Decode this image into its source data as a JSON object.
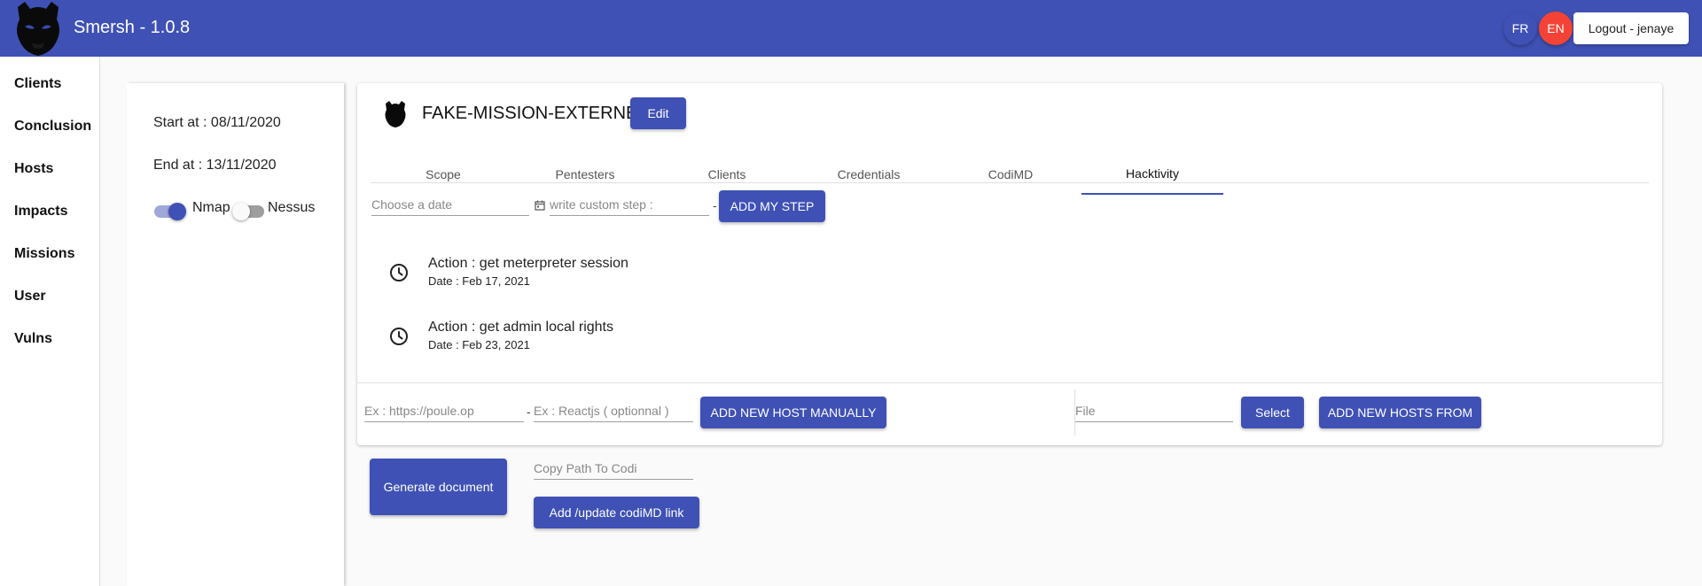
{
  "app": {
    "title": "Smersh - 1.0.8",
    "logo_icon": "panther-head-icon"
  },
  "header": {
    "lang_fr": "FR",
    "lang_en": "EN",
    "logout_label": "Logout - jenaye"
  },
  "colors": {
    "primary": "#3f51b5",
    "accent": "#f44336"
  },
  "sidebar": {
    "items": [
      {
        "label": "Clients"
      },
      {
        "label": "Conclusion"
      },
      {
        "label": "Hosts"
      },
      {
        "label": "Impacts"
      },
      {
        "label": "Missions"
      },
      {
        "label": "User"
      },
      {
        "label": "Vulns"
      }
    ]
  },
  "left_panel": {
    "start": "Start at : 08/11/2020",
    "end": "End at : 13/11/2020",
    "nmap_label": "Nmap",
    "nessus_label": "Nessus",
    "nmap_on": true,
    "nessus_on": false
  },
  "mission": {
    "name": "FAKE-MISSION-EXTERNE",
    "edit_label": "Edit",
    "tabs": [
      {
        "label": "Scope"
      },
      {
        "label": "Pentesters"
      },
      {
        "label": "Clients"
      },
      {
        "label": "Credentials"
      },
      {
        "label": "CodiMD"
      },
      {
        "label": "Hacktivity"
      }
    ],
    "active_tab": "Hacktivity"
  },
  "step_form": {
    "date_placeholder": "Choose a date",
    "calendar_icon": "calendar-icon",
    "step_placeholder": "write custom step :",
    "separator": "-",
    "add_label": "ADD MY STEP"
  },
  "timeline": [
    {
      "action": "Action : get meterpreter session",
      "date": "Date : Feb 17, 2021",
      "icon": "clock-icon"
    },
    {
      "action": "Action : get admin local rights",
      "date": "Date : Feb 23, 2021",
      "icon": "clock-icon"
    }
  ],
  "host_form": {
    "url_placeholder": "Ex : https://poule.op",
    "separator": "-",
    "tech_placeholder": "Ex : Reactjs ( optionnal )",
    "add_manual_label": "ADD NEW HOST MANUALLY",
    "file_placeholder": "File",
    "select_label": "Select",
    "add_from_label": "ADD NEW HOSTS FROM"
  },
  "bottom": {
    "generate_label": "Generate document",
    "codi_placeholder": "Copy Path To Codi",
    "codi_link_label": "Add /update codiMD link"
  }
}
